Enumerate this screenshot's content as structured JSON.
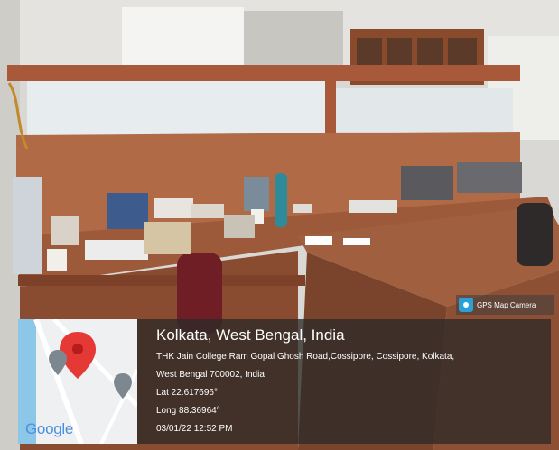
{
  "location": {
    "title": "Kolkata, West Bengal, India",
    "address_line1": "THK Jain College Ram Gopal Ghosh Road,Cossipore, Cossipore, Kolkata,",
    "address_line2": "West Bengal 700002, India",
    "latitude": "Lat 22.617696°",
    "longitude": "Long 88.36964°",
    "timestamp": "03/01/22 12:52 PM"
  },
  "map": {
    "brand": "Google",
    "pin_color": "#e53935",
    "water_color": "#8cc7e8"
  },
  "watermark": {
    "label": "GPS Map Camera",
    "icon": "gps-camera-icon"
  }
}
